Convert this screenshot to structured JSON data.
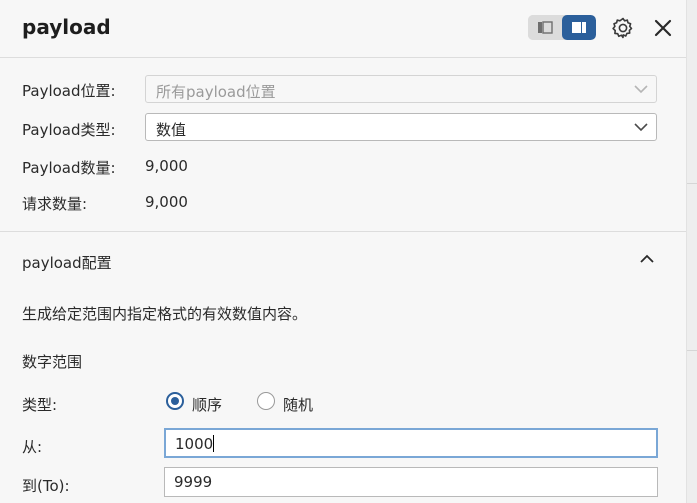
{
  "header": {
    "title": "payload"
  },
  "summary": {
    "position_label": "Payload位置:",
    "position_value": "所有payload位置",
    "type_label": "Payload类型:",
    "type_value": "数值",
    "count_label": "Payload数量:",
    "count_value": "9,000",
    "request_label": "请求数量:",
    "request_value": "9,000"
  },
  "config": {
    "section_title": "payload配置",
    "description": "生成给定范围内指定格式的有效数值内容。",
    "range_heading": "数字范围",
    "type_label": "类型:",
    "options": [
      {
        "label": "顺序",
        "checked": true
      },
      {
        "label": "随机",
        "checked": false
      }
    ],
    "from_label": "从:",
    "from_value": "1000",
    "to_label": "到(To):",
    "to_value": "9999"
  },
  "colors": {
    "accent": "#2b5f9b",
    "focus_border": "#7aa7d6"
  }
}
